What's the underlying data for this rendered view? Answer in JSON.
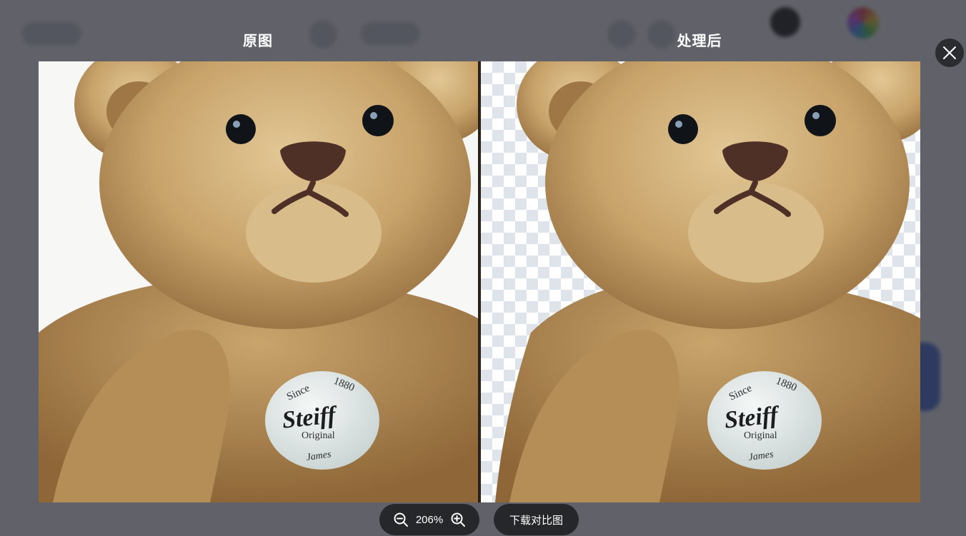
{
  "viewer": {
    "left_title": "原图",
    "right_title": "处理后",
    "zoom_level": "206%",
    "download_label": "下载对比图"
  },
  "badge": {
    "line1": "Since",
    "line1b": "1880",
    "brand": "Steiff",
    "line2": "Original",
    "line3": "James"
  },
  "icons": {
    "close": "close-icon",
    "zoom_out": "zoom-out-icon",
    "zoom_in": "zoom-in-icon"
  },
  "colors": {
    "overlay": "#282a32",
    "pill": "#26272b",
    "fur": "#c8a36a",
    "checker": "#dfe3ea"
  }
}
